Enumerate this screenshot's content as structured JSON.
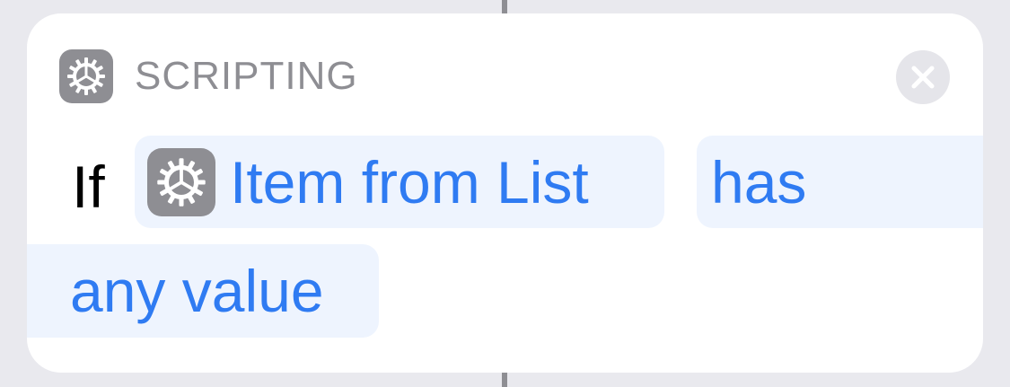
{
  "action": {
    "category": "SCRIPTING",
    "keyword": "If",
    "variable": {
      "label": "Item from List",
      "icon": "gear-icon"
    },
    "condition": {
      "part1": "has",
      "part2": "any value"
    },
    "close": {
      "icon": "close-icon"
    }
  },
  "colors": {
    "background": "#e9e9ee",
    "card": "#ffffff",
    "token_bg": "#eef4fe",
    "token_text": "#2f7bf2",
    "icon_bg": "#8e8e93",
    "category_text": "#8e8e93",
    "close_bg": "#e5e5ea"
  }
}
